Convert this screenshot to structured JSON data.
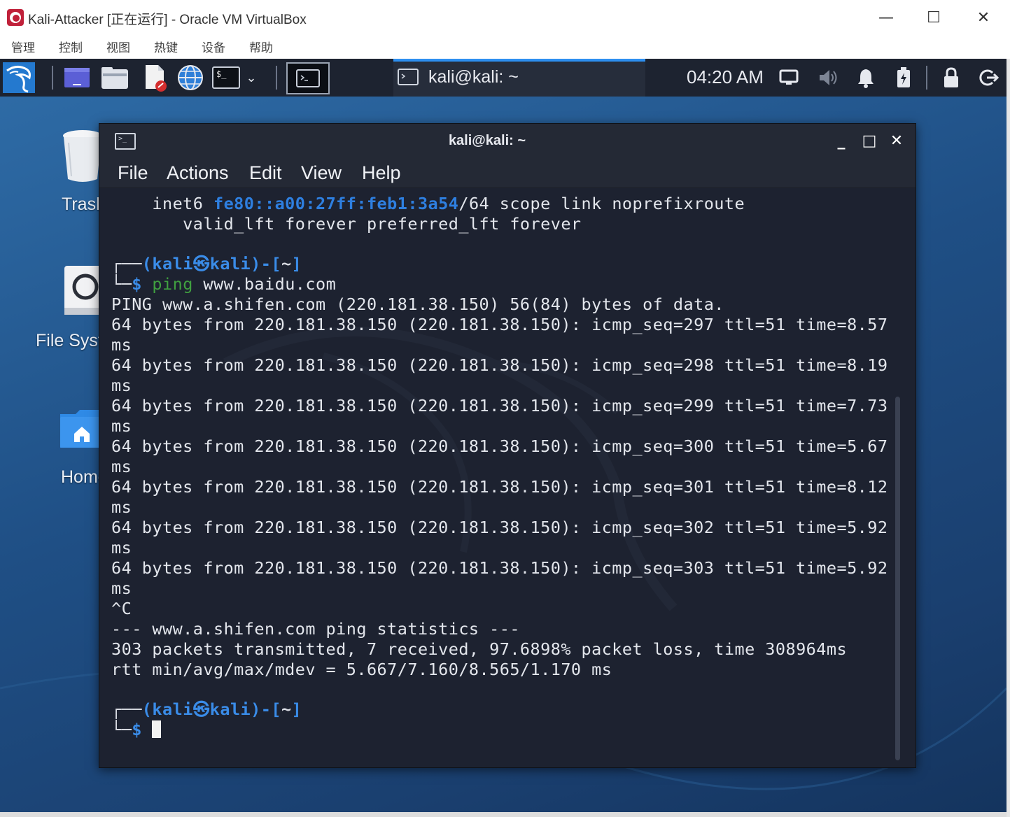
{
  "vbox": {
    "window_title": "Kali-Attacker [正在运行] - Oracle VM VirtualBox",
    "menu": [
      "管理",
      "控制",
      "视图",
      "热键",
      "设备",
      "帮助"
    ],
    "controls": {
      "minimize": "—",
      "maximize": "☐",
      "close": "✕"
    }
  },
  "panel": {
    "taskbar_window_label": "kali@kali: ~",
    "clock": "04:20 AM"
  },
  "desktop": {
    "icons": [
      {
        "label": "Trash"
      },
      {
        "label": "File System"
      },
      {
        "label": "Home"
      }
    ]
  },
  "terminal": {
    "title": "kali@kali: ~",
    "menu": [
      "File",
      "Actions",
      "Edit",
      "View",
      "Help"
    ],
    "controls": {
      "minimize": "_",
      "maximize": "□",
      "close": "✕"
    },
    "inet6": {
      "prefix": "    inet6 ",
      "addr": "fe80::a00:27ff:feb1:3a54",
      "suffix": "/64 scope link noprefixroute",
      "line2": "       valid_lft forever preferred_lft forever"
    },
    "prompt": {
      "corner_top": "┌──",
      "open": "(",
      "user": "kali",
      "at": "㉿",
      "host": "kali",
      "close": ")-[",
      "dir": "~",
      "end": "]",
      "corner_bottom": "└─",
      "dollar": "$"
    },
    "command": {
      "name": "ping",
      "arg": " www.baidu.com"
    },
    "output": [
      "PING www.a.shifen.com (220.181.38.150) 56(84) bytes of data.",
      "64 bytes from 220.181.38.150 (220.181.38.150): icmp_seq=297 ttl=51 time=8.57",
      "ms",
      "64 bytes from 220.181.38.150 (220.181.38.150): icmp_seq=298 ttl=51 time=8.19",
      "ms",
      "64 bytes from 220.181.38.150 (220.181.38.150): icmp_seq=299 ttl=51 time=7.73",
      "ms",
      "64 bytes from 220.181.38.150 (220.181.38.150): icmp_seq=300 ttl=51 time=5.67",
      "ms",
      "64 bytes from 220.181.38.150 (220.181.38.150): icmp_seq=301 ttl=51 time=8.12",
      "ms",
      "64 bytes from 220.181.38.150 (220.181.38.150): icmp_seq=302 ttl=51 time=5.92",
      "ms",
      "64 bytes from 220.181.38.150 (220.181.38.150): icmp_seq=303 ttl=51 time=5.92",
      "ms",
      "^C",
      "--- www.a.shifen.com ping statistics ---",
      "303 packets transmitted, 7 received, 97.6898% packet loss, time 308964ms",
      "rtt min/avg/max/mdev = 5.667/7.160/8.565/1.170 ms"
    ]
  },
  "colors": {
    "panel_bg": "#1d2330",
    "terminal_bg": "#1d2230",
    "prompt_blue": "#2e7fe0",
    "command_green": "#40a040",
    "taskbar_accent": "#2d8ff0"
  },
  "icons": [
    "kali-dragon-icon",
    "show-desktop-icon",
    "file-manager-icon",
    "text-editor-icon",
    "web-browser-icon",
    "terminal-icon",
    "screen-icon",
    "volume-icon",
    "bell-icon",
    "battery-icon",
    "lock-icon",
    "logout-icon",
    "trash-icon",
    "drive-icon",
    "home-folder-icon"
  ]
}
